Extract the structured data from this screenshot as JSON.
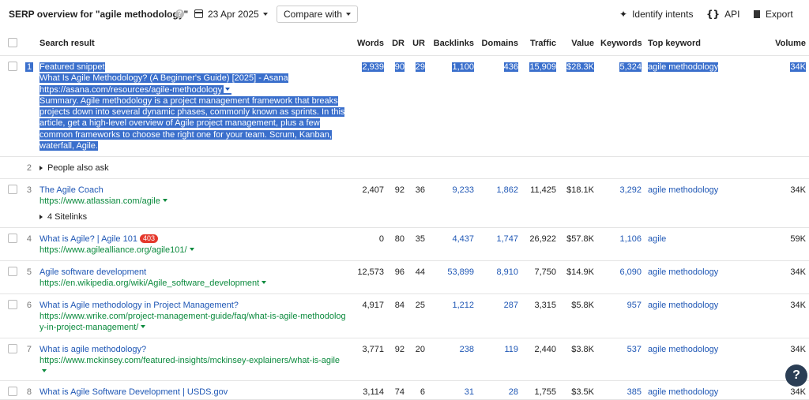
{
  "header": {
    "title": "SERP overview for \"agile methodology\"",
    "help": "?",
    "date": "23 Apr 2025",
    "compare": "Compare with",
    "identify": "Identify intents",
    "api": "API",
    "export": "Export"
  },
  "columns": [
    "Search result",
    "Words",
    "DR",
    "UR",
    "Backlinks",
    "Domains",
    "Traffic",
    "Value",
    "Keywords",
    "Top keyword",
    "Volume"
  ],
  "rows": [
    {
      "num": "1",
      "label": "Featured snippet",
      "title": "What Is Agile Methodology? (A Beginner's Guide) [2025] - Asana",
      "url": "https://asana.com/resources/agile-methodology",
      "snippet": "Summary. Agile methodology is a project management framework that breaks projects down into several dynamic phases, commonly known as sprints. In this article, get a high-level overview of Agile project management, plus a few common frameworks to choose the right one for your team. Scrum, Kanban, waterfall, Agile.",
      "words": "2,939",
      "dr": "90",
      "ur": "29",
      "backlinks": "1,100",
      "domains": "436",
      "traffic": "15,909",
      "value": "$28.3K",
      "keywords": "5,324",
      "top_keyword": "agile methodology",
      "volume": "34K"
    },
    {
      "num": "2",
      "label": "People also ask"
    },
    {
      "num": "3",
      "title": "The Agile Coach",
      "url": "https://www.atlassian.com/agile",
      "sitelinks": "4 Sitelinks",
      "words": "2,407",
      "dr": "92",
      "ur": "36",
      "backlinks": "9,233",
      "domains": "1,862",
      "traffic": "11,425",
      "value": "$18.1K",
      "keywords": "3,292",
      "top_keyword": "agile methodology",
      "volume": "34K"
    },
    {
      "num": "4",
      "title": "What is Agile? | Agile 101",
      "badge": "403",
      "url": "https://www.agilealliance.org/agile101/",
      "words": "0",
      "dr": "80",
      "ur": "35",
      "backlinks": "4,437",
      "domains": "1,747",
      "traffic": "26,922",
      "value": "$57.8K",
      "keywords": "1,106",
      "top_keyword": "agile",
      "volume": "59K"
    },
    {
      "num": "5",
      "title": "Agile software development",
      "url": "https://en.wikipedia.org/wiki/Agile_software_development",
      "words": "12,573",
      "dr": "96",
      "ur": "44",
      "backlinks": "53,899",
      "domains": "8,910",
      "traffic": "7,750",
      "value": "$14.9K",
      "keywords": "6,090",
      "top_keyword": "agile methodology",
      "volume": "34K"
    },
    {
      "num": "6",
      "title": "What is Agile methodology in Project Management?",
      "url": "https://www.wrike.com/project-management-guide/faq/what-is-agile-methodology-in-project-management/",
      "words": "4,917",
      "dr": "84",
      "ur": "25",
      "backlinks": "1,212",
      "domains": "287",
      "traffic": "3,315",
      "value": "$5.8K",
      "keywords": "957",
      "top_keyword": "agile methodology",
      "volume": "34K"
    },
    {
      "num": "7",
      "title": "What is agile methodology?",
      "url": "https://www.mckinsey.com/featured-insights/mckinsey-explainers/what-is-agile",
      "words": "3,771",
      "dr": "92",
      "ur": "20",
      "backlinks": "238",
      "domains": "119",
      "traffic": "2,440",
      "value": "$3.8K",
      "keywords": "537",
      "top_keyword": "agile methodology",
      "volume": "34K"
    },
    {
      "num": "8",
      "title": "What is Agile Software Development | USDS.gov",
      "words": "3,114",
      "dr": "74",
      "ur": "6",
      "backlinks": "31",
      "domains": "28",
      "traffic": "1,755",
      "value": "$3.5K",
      "keywords": "385",
      "top_keyword": "agile methodology",
      "volume": "34K"
    }
  ],
  "help_button": "?",
  "colors": {
    "link": "#1f57b5",
    "url": "#0b8a3d",
    "highlight": "#3a6fcc",
    "badge": "#e5392d"
  }
}
